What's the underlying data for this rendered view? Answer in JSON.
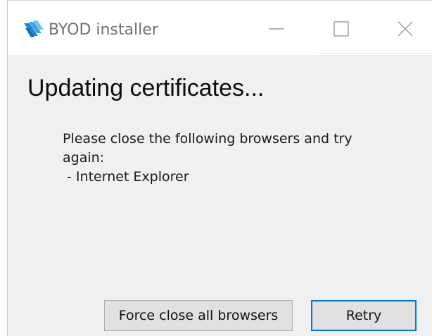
{
  "window": {
    "title": "BYOD installer",
    "controls": {
      "minimize_icon": "minimize-icon",
      "maximize_icon": "maximize-icon",
      "close_icon": "close-icon"
    }
  },
  "main": {
    "heading": "Updating certificates...",
    "message_lines": [
      "Please close the following browsers and try",
      "again:",
      " - Internet Explorer"
    ]
  },
  "buttons": {
    "force_close_label": "Force close all browsers",
    "retry_label": "Retry"
  },
  "colors": {
    "accent": "#0078d7",
    "window_bg": "#f0f0f0",
    "titlebar_bg": "#ffffff",
    "icon_blue": "#2a8fd4"
  }
}
